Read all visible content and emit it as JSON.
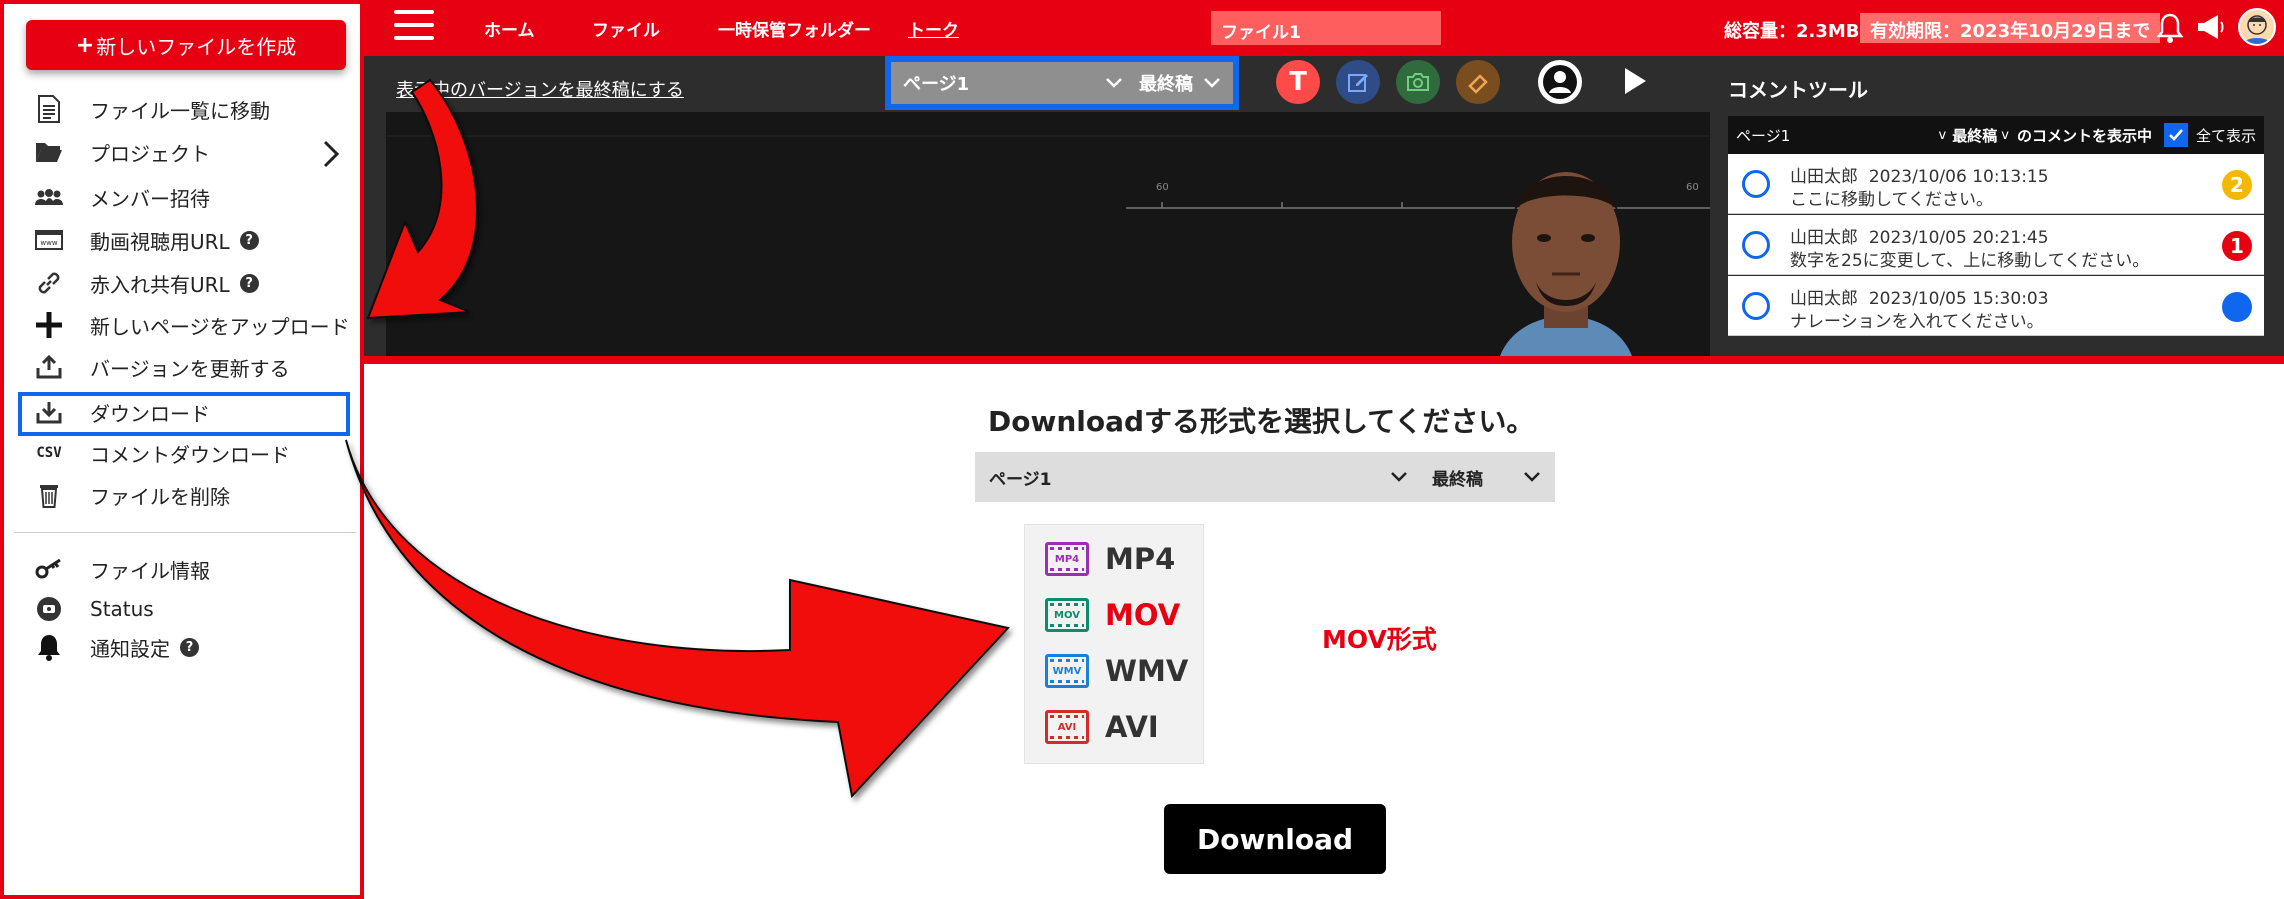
{
  "sidebar": {
    "new_file_label": "新しいファイルを作成",
    "items": [
      {
        "label": "ファイル一覧に移動"
      },
      {
        "label": "プロジェクト"
      },
      {
        "label": "メンバー招待"
      },
      {
        "label": "動画視聴用URL"
      },
      {
        "label": "赤入れ共有URL"
      },
      {
        "label": "新しいページをアップロード"
      },
      {
        "label": "バージョンを更新する"
      },
      {
        "label": "ダウンロード"
      },
      {
        "label": "コメントダウンロード"
      },
      {
        "label": "ファイルを削除"
      },
      {
        "label": "ファイル情報"
      },
      {
        "label": "Status"
      },
      {
        "label": "通知設定"
      }
    ],
    "help_glyph": "?",
    "csv_label": "CSV"
  },
  "topbar": {
    "nav": [
      "ホーム",
      "ファイル",
      "一時保管フォルダー",
      "トーク"
    ],
    "file_field": "ファイル1",
    "storage": "総容量：2.3MB",
    "expiry": "有効期限：2023年10月29日まで"
  },
  "viewer": {
    "set_final_link": "表示中のバージョンを最終稿にする",
    "page_label": "ページ1",
    "version_label": "最終稿",
    "text_tool": "T",
    "ruler_labels": [
      "60",
      "60"
    ]
  },
  "comments": {
    "title": "コメントツール",
    "filter_page": "ページ1",
    "filter_version": "最終稿",
    "filter_suffix": "のコメントを表示中",
    "show_all": "全て表示",
    "rows": [
      {
        "author": "山田太郎",
        "time": "2023/10/06 10:13:15",
        "message": "ここに移動してください。",
        "badge": "2",
        "badge_color": "#f5b800"
      },
      {
        "author": "山田太郎",
        "time": "2023/10/05 20:21:45",
        "message": "数字を25に変更して、上に移動してください。",
        "badge": "1",
        "badge_color": "#e60012"
      },
      {
        "author": "山田太郎",
        "time": "2023/10/05 15:30:03",
        "message": "ナレーションを入れてください。",
        "badge": "",
        "badge_color": "#1166ee"
      }
    ]
  },
  "dialog": {
    "title": "Downloadする形式を選択してください。",
    "page_label": "ページ1",
    "version_label": "最終稿",
    "formats": [
      {
        "label": "MP4",
        "icon_text": "MP4",
        "color": "#9b2fb3",
        "label_color": "#333333"
      },
      {
        "label": "MOV",
        "icon_text": "MOV",
        "color": "#0e8a6c",
        "label_color": "#e60012"
      },
      {
        "label": "WMV",
        "icon_text": "WMV",
        "color": "#1a7fd6",
        "label_color": "#333333"
      },
      {
        "label": "AVI",
        "icon_text": "AVI",
        "color": "#d42a2a",
        "label_color": "#333333"
      }
    ],
    "selected_note": "MOV形式",
    "download_label": "Download"
  },
  "colors": {
    "brand": "#e60012",
    "highlight": "#1166ee"
  }
}
